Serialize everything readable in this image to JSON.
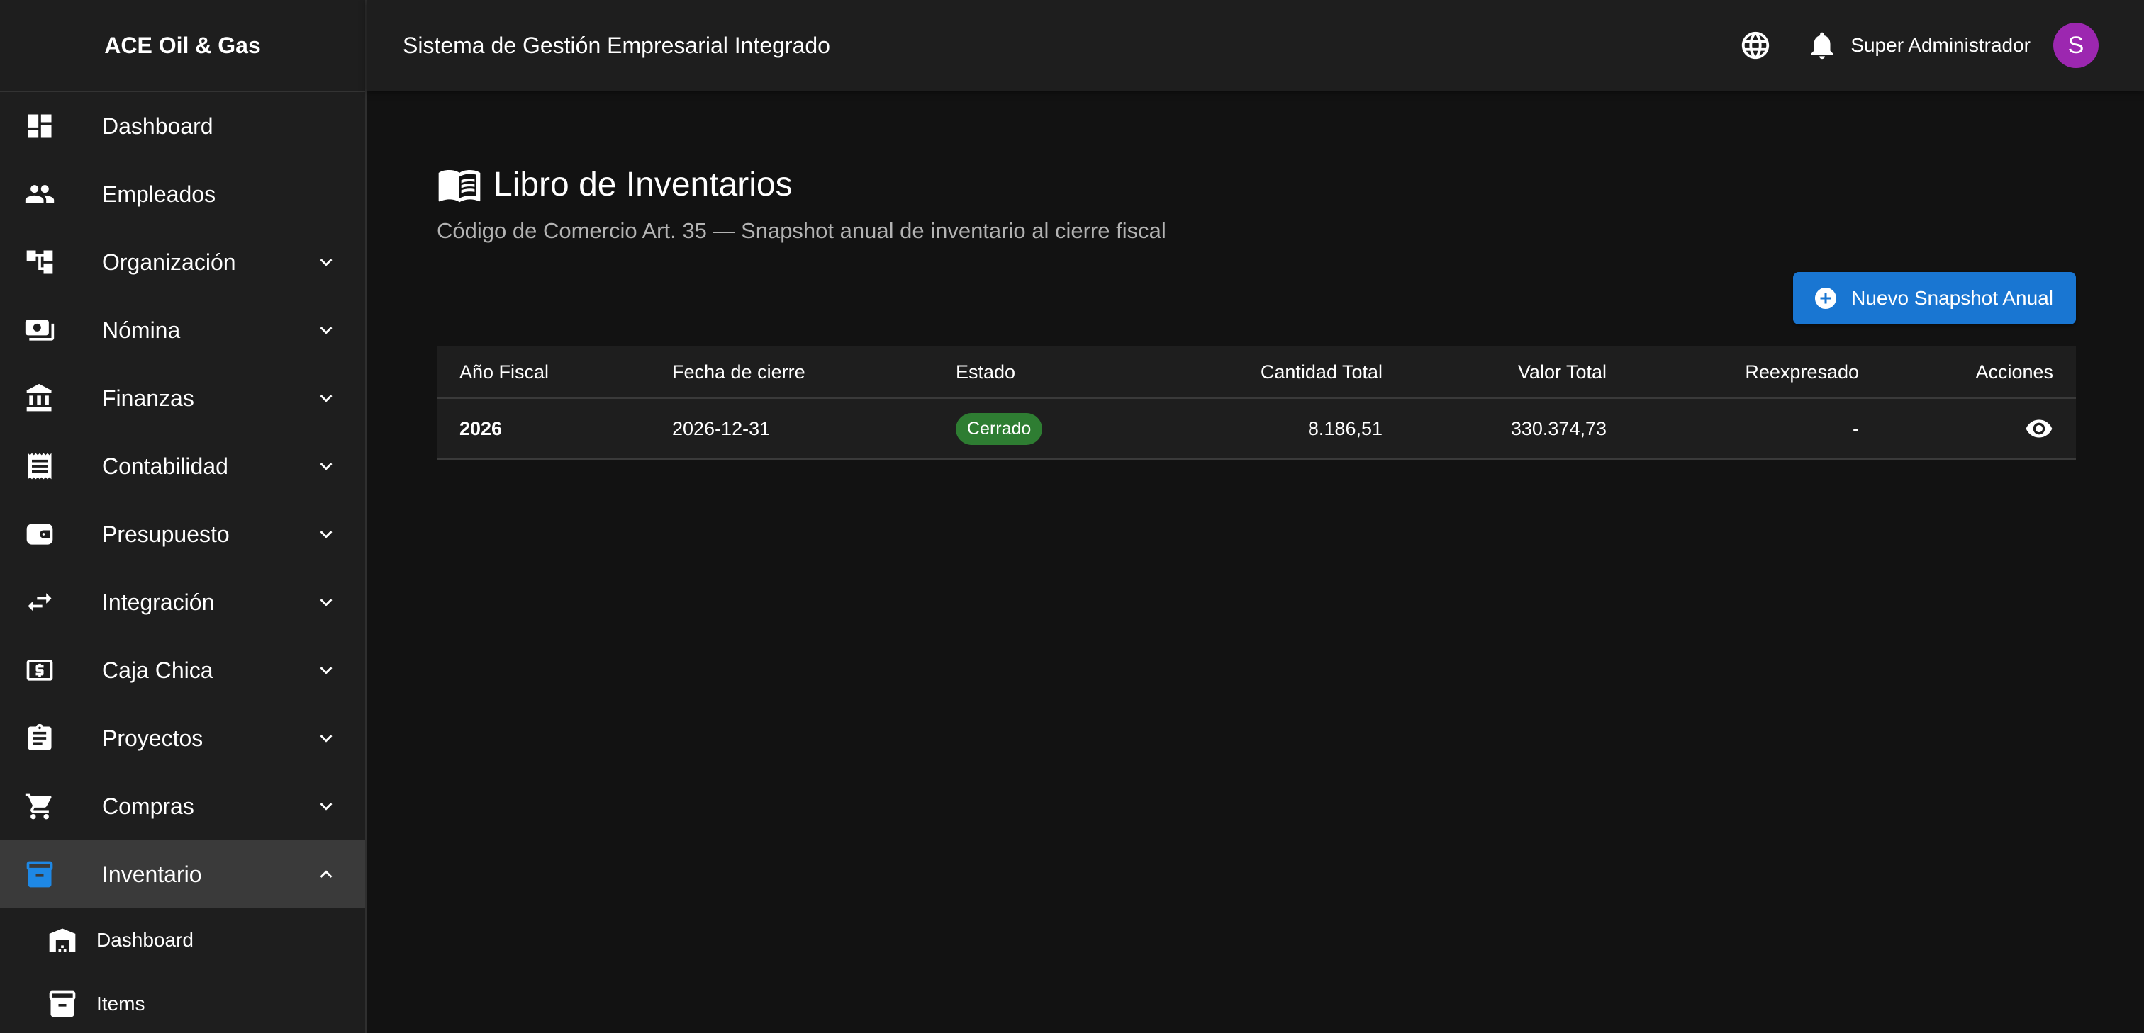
{
  "sidebar": {
    "brand": "ACE Oil & Gas",
    "items": [
      {
        "label": "Dashboard",
        "icon": "dashboard-icon",
        "expandable": false
      },
      {
        "label": "Empleados",
        "icon": "people-icon",
        "expandable": false
      },
      {
        "label": "Organización",
        "icon": "org-tree-icon",
        "expandable": true
      },
      {
        "label": "Nómina",
        "icon": "payroll-money-icon",
        "expandable": true
      },
      {
        "label": "Finanzas",
        "icon": "bank-icon",
        "expandable": true
      },
      {
        "label": "Contabilidad",
        "icon": "receipt-icon",
        "expandable": true
      },
      {
        "label": "Presupuesto",
        "icon": "wallet-icon",
        "expandable": true
      },
      {
        "label": "Integración",
        "icon": "swap-arrows-icon",
        "expandable": true
      },
      {
        "label": "Caja Chica",
        "icon": "cash-box-icon",
        "expandable": true
      },
      {
        "label": "Proyectos",
        "icon": "clipboard-icon",
        "expandable": true
      },
      {
        "label": "Compras",
        "icon": "shopping-cart-icon",
        "expandable": true
      },
      {
        "label": "Inventario",
        "icon": "archive-box-icon",
        "expandable": true,
        "expanded": true
      }
    ],
    "sub_items": [
      {
        "label": "Dashboard",
        "icon": "warehouse-icon"
      },
      {
        "label": "Items",
        "icon": "inventory-box-icon"
      }
    ]
  },
  "topbar": {
    "title": "Sistema de Gestión Empresarial Integrado",
    "user_name": "Super Administrador",
    "avatar_initial": "S"
  },
  "page": {
    "title": "Libro de Inventarios",
    "subtitle": "Código de Comercio Art. 35 — Snapshot anual de inventario al cierre fiscal",
    "new_button_label": "Nuevo Snapshot Anual"
  },
  "table": {
    "headers": {
      "anio": "Año Fiscal",
      "fecha": "Fecha de cierre",
      "estado": "Estado",
      "cantidad": "Cantidad Total",
      "valor": "Valor Total",
      "reexpresado": "Reexpresado",
      "acciones": "Acciones"
    },
    "rows": [
      {
        "anio": "2026",
        "fecha": "2026-12-31",
        "estado": "Cerrado",
        "cantidad": "8.186,51",
        "valor": "330.374,73",
        "reexpresado": "-"
      }
    ]
  },
  "colors": {
    "accent": "#1976d2",
    "active_icon": "#1e88e5",
    "status_closed": "#2e7d32",
    "avatar": "#9c27b0"
  }
}
